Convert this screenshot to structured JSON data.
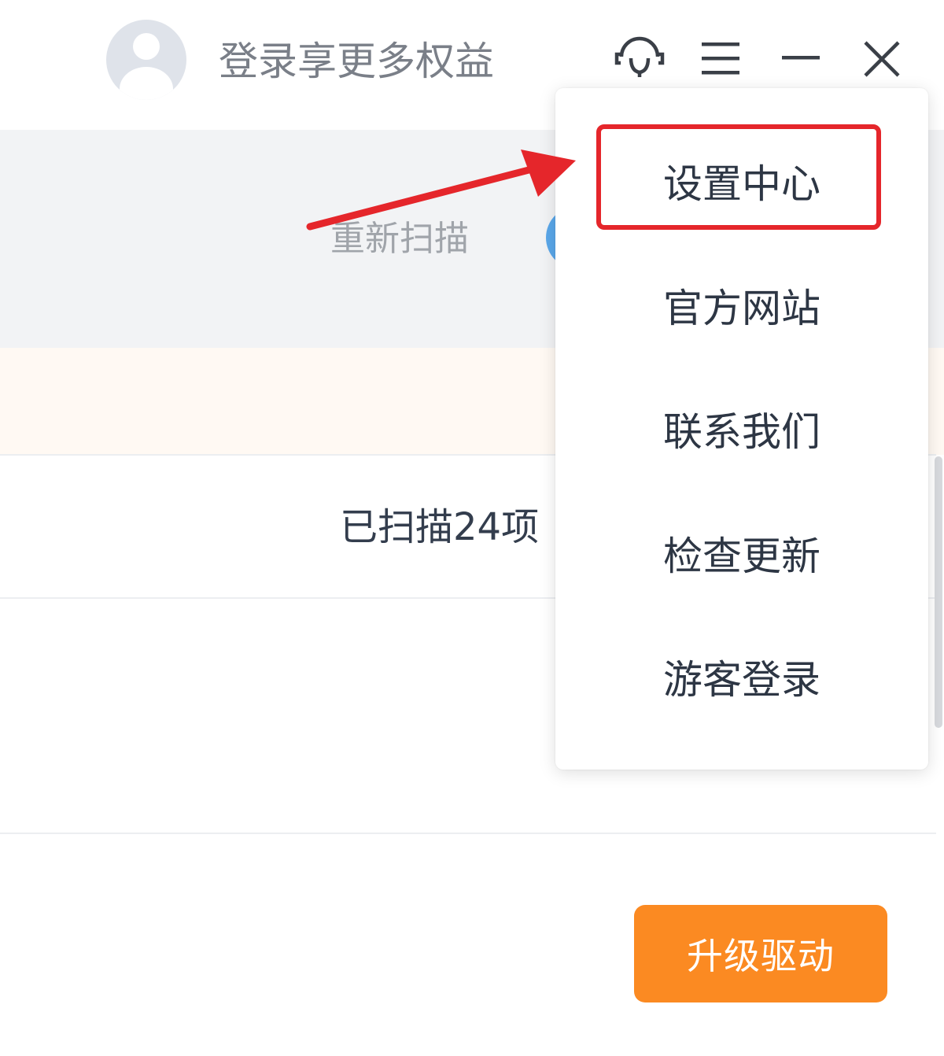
{
  "header": {
    "login_prompt": "登录享更多权益",
    "icons": {
      "support": "headset-icon",
      "menu": "hamburger-menu-icon",
      "minimize": "minimize-icon",
      "close": "close-icon"
    }
  },
  "scan": {
    "rescan_label": "重新扫描",
    "scanned_summary": "已扫描24项"
  },
  "menu": {
    "items": [
      {
        "label": "设置中心",
        "highlighted": true
      },
      {
        "label": "官方网站"
      },
      {
        "label": "联系我们"
      },
      {
        "label": "检查更新"
      },
      {
        "label": "游客登录"
      }
    ]
  },
  "actions": {
    "upgrade_label": "升级驱动"
  },
  "colors": {
    "accent_orange": "#fb8a22",
    "annotation_red": "#e5262b",
    "scan_band_bg": "#f2f3f5",
    "notice_band_bg": "#fff9f3",
    "avatar_bg": "#dfe3ea"
  }
}
